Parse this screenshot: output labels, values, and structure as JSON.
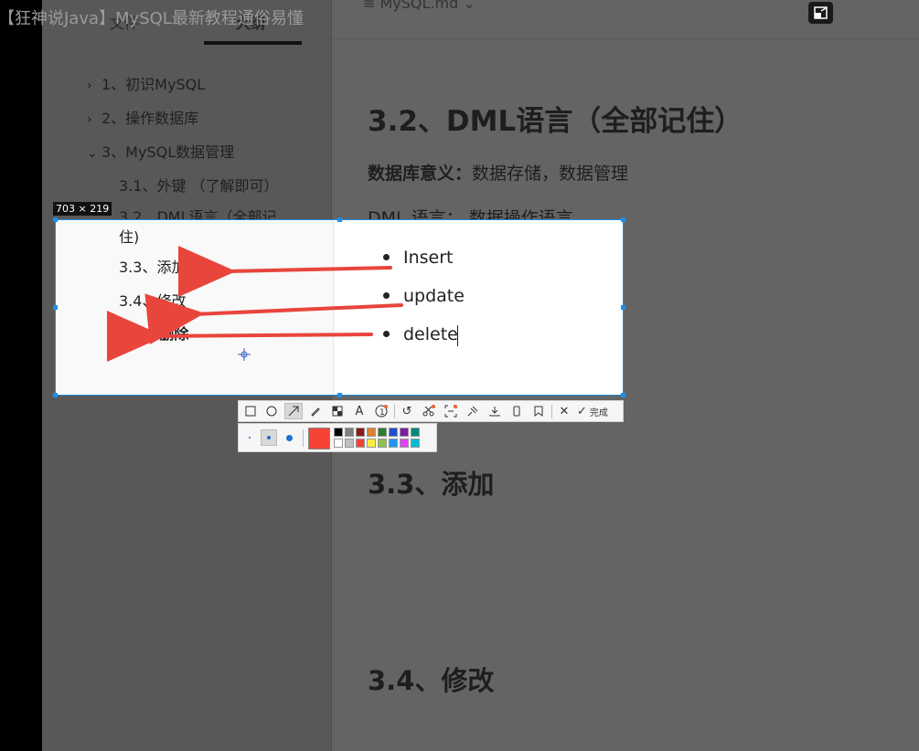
{
  "video_title": "【狂神说Java】MySQL最新教程通俗易懂",
  "file_tab": "MySQL.md",
  "sidebar": {
    "tabs": [
      "文件",
      "大纲"
    ],
    "toc": [
      {
        "label": "1、初识MySQL",
        "chevron": ">"
      },
      {
        "label": "2、操作数据库",
        "chevron": ">"
      },
      {
        "label": "3、MySQL数据管理",
        "chevron": "v"
      },
      {
        "label": "3.1、外键 （了解即可）"
      },
      {
        "label_line1": "3.2、DML语言（全部记",
        "label_line2": "住)"
      },
      {
        "label": "3.3、添加"
      },
      {
        "label": "3.4、修改"
      },
      {
        "label": "3.5、删除"
      }
    ]
  },
  "doc": {
    "heading_dml": "3.2、DML语言（全部记住）",
    "db_meaning_label": "数据库意义：",
    "db_meaning_value": "数据存储，数据管理",
    "dml_line": "DML 语言： 数据操作语言",
    "bullets": [
      "Insert",
      "update",
      "delete"
    ],
    "heading_add": "3.3、添加",
    "heading_update": "3.4、修改"
  },
  "screenshot_tool": {
    "size_label": "703 × 219",
    "done_label": "完成",
    "arrow_color": "#e8453c",
    "selected_color": "#f44336",
    "palette": [
      "#000000",
      "#808080",
      "#8b1a1a",
      "#e08030",
      "#2e7d32",
      "#1e50c8",
      "#7b1fa2",
      "#00897b",
      "#ffffff",
      "#c0c0c0",
      "#f44336",
      "#ffeb3b",
      "#8bc34a",
      "#2196f3",
      "#e040fb",
      "#00bcd4"
    ]
  }
}
